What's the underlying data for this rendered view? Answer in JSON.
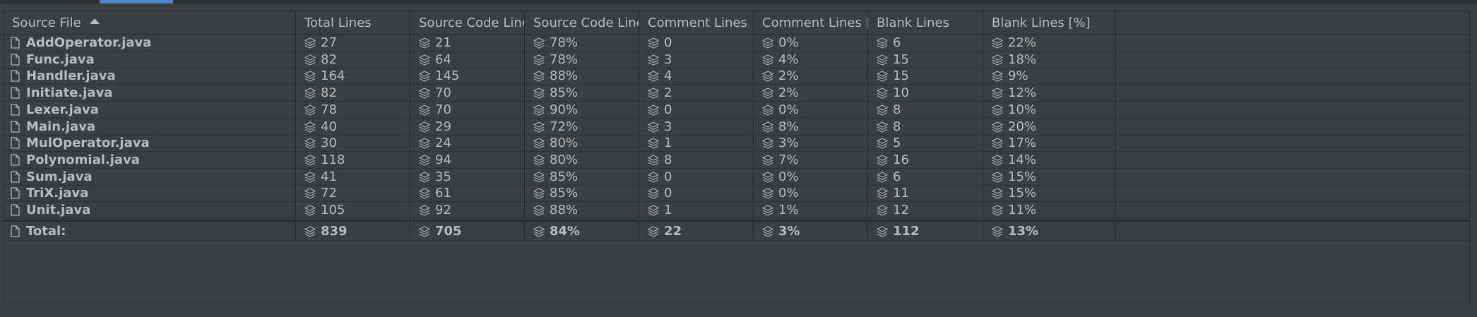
{
  "columns": [
    {
      "label": "Source File",
      "sorted": "ascending"
    },
    {
      "label": "Total Lines"
    },
    {
      "label": "Source Code Lines"
    },
    {
      "label": "Source Code Lines [%]"
    },
    {
      "label": "Comment Lines"
    },
    {
      "label": "Comment Lines [%]"
    },
    {
      "label": "Blank Lines"
    },
    {
      "label": "Blank Lines [%]"
    }
  ],
  "rows": [
    {
      "file": "AddOperator.java",
      "total": "27",
      "src": "21",
      "src_pct": "78%",
      "comment": "0",
      "comment_pct": "0%",
      "blank": "6",
      "blank_pct": "22%"
    },
    {
      "file": "Func.java",
      "total": "82",
      "src": "64",
      "src_pct": "78%",
      "comment": "3",
      "comment_pct": "4%",
      "blank": "15",
      "blank_pct": "18%"
    },
    {
      "file": "Handler.java",
      "total": "164",
      "src": "145",
      "src_pct": "88%",
      "comment": "4",
      "comment_pct": "2%",
      "blank": "15",
      "blank_pct": "9%"
    },
    {
      "file": "Initiate.java",
      "total": "82",
      "src": "70",
      "src_pct": "85%",
      "comment": "2",
      "comment_pct": "2%",
      "blank": "10",
      "blank_pct": "12%"
    },
    {
      "file": "Lexer.java",
      "total": "78",
      "src": "70",
      "src_pct": "90%",
      "comment": "0",
      "comment_pct": "0%",
      "blank": "8",
      "blank_pct": "10%"
    },
    {
      "file": "Main.java",
      "total": "40",
      "src": "29",
      "src_pct": "72%",
      "comment": "3",
      "comment_pct": "8%",
      "blank": "8",
      "blank_pct": "20%"
    },
    {
      "file": "MulOperator.java",
      "total": "30",
      "src": "24",
      "src_pct": "80%",
      "comment": "1",
      "comment_pct": "3%",
      "blank": "5",
      "blank_pct": "17%"
    },
    {
      "file": "Polynomial.java",
      "total": "118",
      "src": "94",
      "src_pct": "80%",
      "comment": "8",
      "comment_pct": "7%",
      "blank": "16",
      "blank_pct": "14%"
    },
    {
      "file": "Sum.java",
      "total": "41",
      "src": "35",
      "src_pct": "85%",
      "comment": "0",
      "comment_pct": "0%",
      "blank": "6",
      "blank_pct": "15%"
    },
    {
      "file": "TriX.java",
      "total": "72",
      "src": "61",
      "src_pct": "85%",
      "comment": "0",
      "comment_pct": "0%",
      "blank": "11",
      "blank_pct": "15%"
    },
    {
      "file": "Unit.java",
      "total": "105",
      "src": "92",
      "src_pct": "88%",
      "comment": "1",
      "comment_pct": "1%",
      "blank": "12",
      "blank_pct": "11%"
    }
  ],
  "totals": {
    "file": "Total:",
    "total": "839",
    "src": "705",
    "src_pct": "84%",
    "comment": "22",
    "comment_pct": "3%",
    "blank": "112",
    "blank_pct": "13%"
  },
  "icons": {
    "file": "file-icon",
    "value": "stack-icon"
  },
  "colors": {
    "background": "#3c3f41",
    "text": "#bbbbbb",
    "grid": "#2b2b2b",
    "accent": "#4a88c7"
  }
}
